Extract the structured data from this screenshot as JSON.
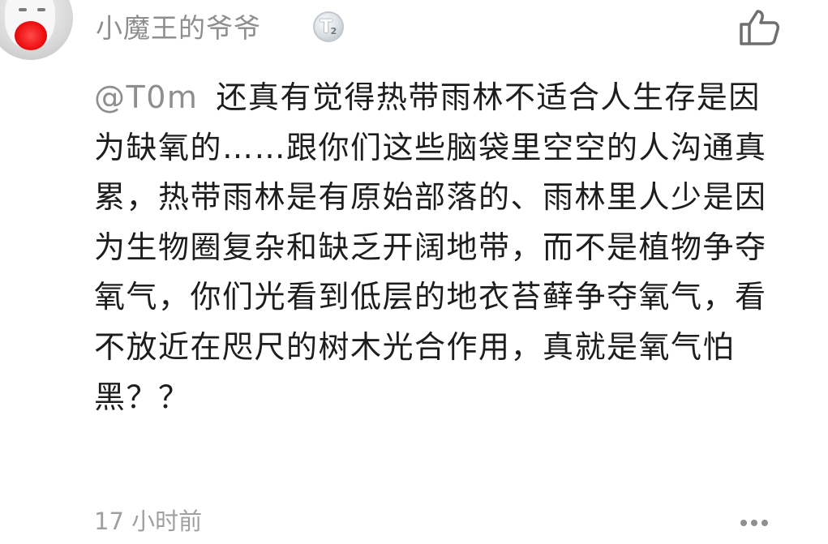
{
  "comment": {
    "username": "小魔王的爷爷",
    "badge": {
      "letter": "T",
      "level": "2"
    },
    "mention": "@T0m",
    "text": "还真有觉得热带雨林不适合人生存是因为缺氧的……跟你们这些脑袋里空空的人沟通真累，热带雨林是有原始部落的、雨林里人少是因为生物圈复杂和缺乏开阔地带，而不是植物争夺氧气，你们光看到低层的地衣苔藓争夺氧气，看不放近在咫尺的树木光合作用，真就是氧气怕黑？？",
    "timestamp": "17 小时前"
  },
  "icons": {
    "avatar": "user-avatar",
    "like": "thumbs-up-icon",
    "more": "more-dots-icon",
    "badge": "level-badge-icon"
  },
  "colors": {
    "username": "#8e8e8e",
    "mention": "#8e8e8e",
    "body_text": "#1d1d1d",
    "timestamp": "#a0a0a0"
  }
}
